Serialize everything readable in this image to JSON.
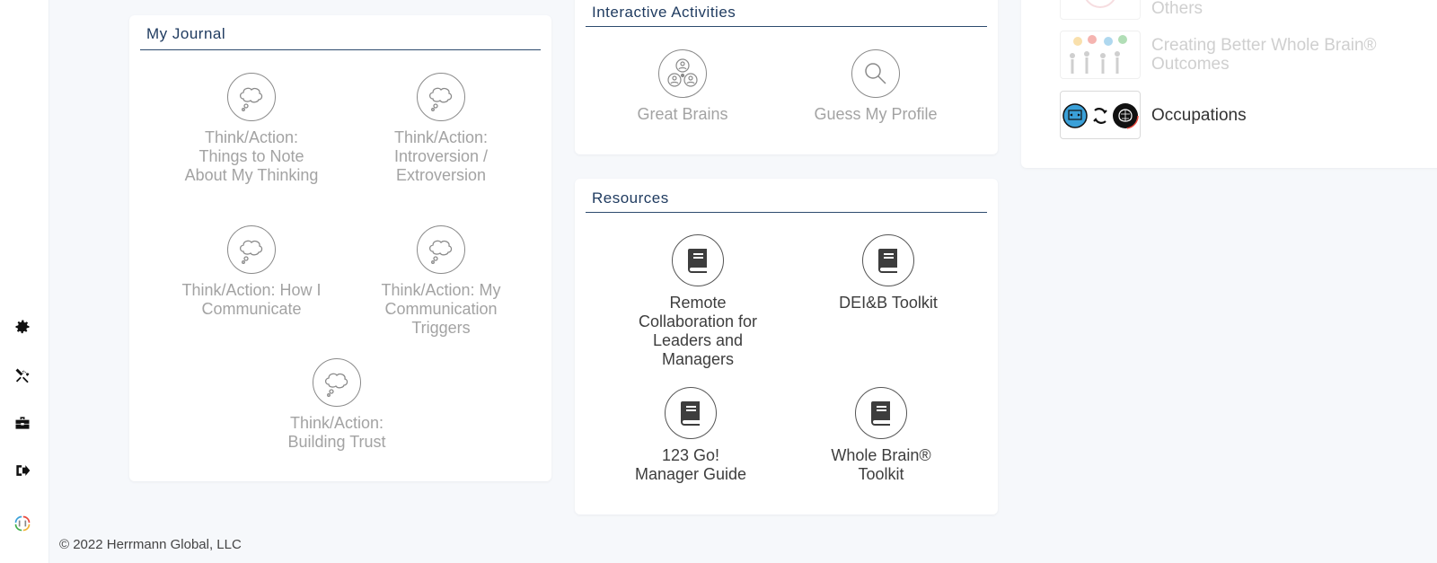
{
  "sidebar": {
    "icons": [
      "gear-icon",
      "tools-icon",
      "toolbox-icon",
      "sign-out-icon",
      "logo-icon"
    ]
  },
  "journal": {
    "title": "My Journal",
    "items": [
      {
        "label": "Think/Action: Things to Note About My Thinking"
      },
      {
        "label": "Think/Action: Introversion / Extroversion"
      },
      {
        "label": "Think/Action: How I Communicate"
      },
      {
        "label": "Think/Action: My Communication Triggers"
      },
      {
        "label": "Think/Action: Building Trust"
      }
    ]
  },
  "activities": {
    "title": "Interactive Activities",
    "items": [
      {
        "label": "Great Brains"
      },
      {
        "label": "Guess My Profile"
      }
    ]
  },
  "resources": {
    "title": "Resources",
    "items": [
      {
        "label": "Remote Collaboration for Leaders and Managers"
      },
      {
        "label": "DEI&B Toolkit"
      },
      {
        "label": "123 Go! Manager Guide"
      },
      {
        "label": "Whole Brain® Toolkit"
      }
    ]
  },
  "list": {
    "items": [
      {
        "label": "Others",
        "faded": true
      },
      {
        "label": "Creating Better Whole Brain® Outcomes",
        "faded": true
      },
      {
        "label": "Occupations",
        "faded": false
      }
    ]
  },
  "footer": {
    "copyright": "© 2022 Herrmann Global, LLC"
  },
  "colors": {
    "heading": "#1e3a5f",
    "muted_text": "#a3a3a3",
    "dark_text": "#3d3d3d"
  }
}
